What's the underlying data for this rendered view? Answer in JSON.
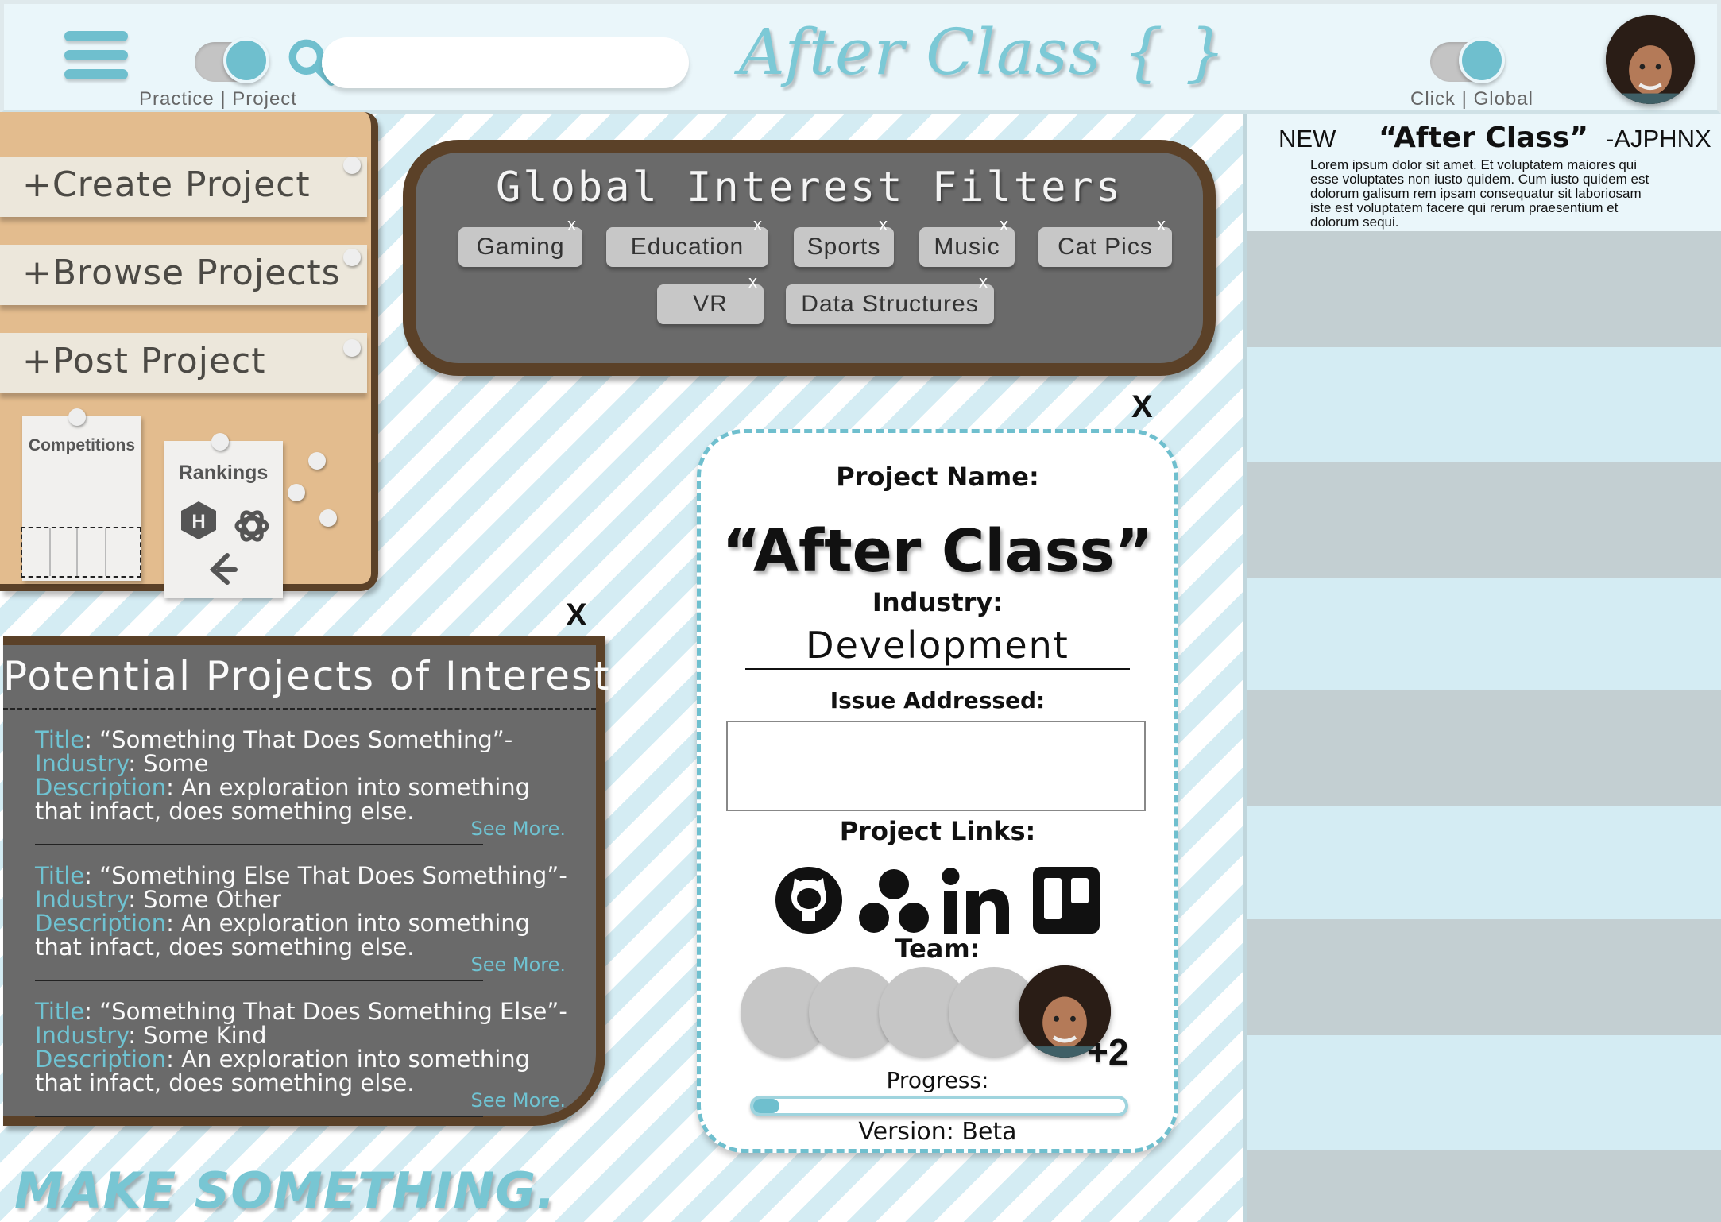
{
  "header": {
    "logo_text": "After Class { }",
    "mode_toggle": {
      "left": "Practice",
      "separator": "|",
      "right": "Project"
    },
    "scope_toggle": {
      "left": "Click",
      "separator": "|",
      "right": "Global"
    },
    "search": {
      "placeholder": "",
      "value": ""
    }
  },
  "sidebar": {
    "items": [
      {
        "label": "+Create Project"
      },
      {
        "label": "+Browse Projects"
      },
      {
        "label": "+Post Project"
      }
    ],
    "competitions": {
      "label": "Competitions"
    },
    "rankings": {
      "label": "Rankings",
      "icons": [
        "hackerrank-icon",
        "openai-icon",
        "leetcode-icon"
      ]
    }
  },
  "filters": {
    "title": "Global Interest Filters",
    "remove_glyph": "x",
    "chips": [
      "Gaming",
      "Education",
      "Sports",
      "Music",
      "Cat Pics",
      "VR",
      "Data Structures"
    ]
  },
  "potential": {
    "title": "Potential Projects of Interest",
    "close_glyph": "X",
    "keys": {
      "title": "Title",
      "industry": "Industry",
      "description": "Description"
    },
    "see_more": "See More.",
    "items": [
      {
        "title": ": “Something That Does Something”-",
        "industry": ": Some",
        "description": ": An exploration into something that infact, does something else."
      },
      {
        "title": ": “Something Else That Does Something”-",
        "industry": ": Some Other",
        "description": ": An exploration into something that infact, does something else."
      },
      {
        "title": ": “Something That Does Something Else”-",
        "industry": ": Some Kind",
        "description": ": An exploration into something that infact, does something else."
      }
    ]
  },
  "card": {
    "close_glyph": "X",
    "name_label": "Project Name:",
    "name": "“After Class”",
    "industry_label": "Industry:",
    "industry": "Development",
    "issue_label": "Issue Addressed:",
    "issue_value": "",
    "links_label": "Project Links:",
    "links": [
      "github-icon",
      "asana-icon",
      "linkedin-icon",
      "trello-icon"
    ],
    "team_label": "Team:",
    "team_more": "+2",
    "progress_label": "Progress:",
    "progress_fraction": 0.07,
    "version": "Version: Beta"
  },
  "feed": {
    "tag": "NEW",
    "title": "“After Class”",
    "author": "-AJPHNX",
    "body": "Lorem ipsum dolor sit amet. Et voluptatem maiores qui esse voluptates non iusto quidem. Cum iusto quidem est dolorum galisum rem ipsam consequatur sit laboriosam iste est voluptatem facere qui rerum praesentium et dolorum sequi."
  },
  "slogan": "MAKE SOMETHING.",
  "colors": {
    "accent": "#6fbfce",
    "cork": "#e3bc8e",
    "wood": "#5b4128",
    "panel": "#6a6a6a"
  }
}
